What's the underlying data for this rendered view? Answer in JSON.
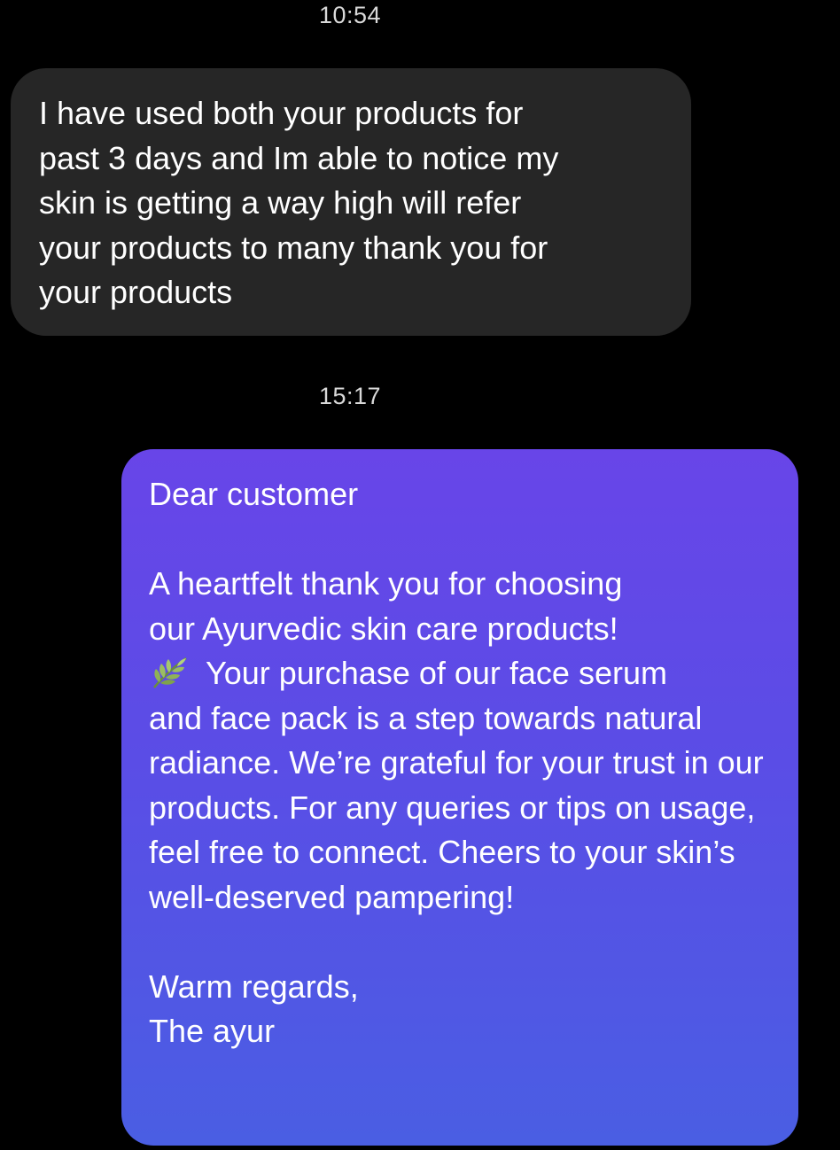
{
  "conversation": {
    "timestamps": [
      "10:54",
      "15:17"
    ],
    "incoming_message": {
      "text": "I have used both your products for\npast 3 days and Im able to notice my\nskin is getting a way high will refer\nyour products to many thank you for\nyour products"
    },
    "outgoing_message": {
      "greeting": "Dear customer",
      "body_line_1": "A heartfelt thank you for choosing",
      "body_line_2": "our Ayurvedic skin care products!",
      "leaf_icon": "herb-leaf-icon",
      "body_after_icon": "Your purchase of our face serum",
      "body_rest": "and face pack is a step towards natural radiance. We’re grateful for your trust in our products. For any queries or tips on usage, feel free to connect. Cheers to your skin’s well-deserved pampering!",
      "signoff": "Warm regards,",
      "signature": "The ayur"
    }
  },
  "colors": {
    "background": "#000000",
    "incoming_bubble": "#262626",
    "outgoing_gradient_top": "#6845e8",
    "outgoing_gradient_bottom": "#4a5ee3",
    "timestamp_text": "#d9d9d9"
  }
}
